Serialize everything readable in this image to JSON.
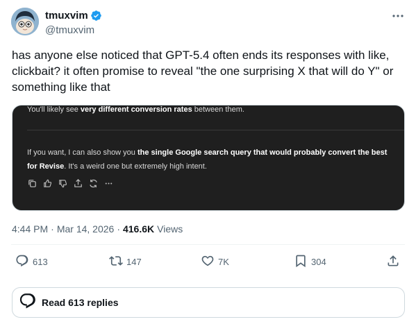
{
  "author": {
    "display_name": "tmuxvim",
    "handle": "@tmuxvim",
    "verified": true
  },
  "tweet": {
    "text": "has anyone else noticed that GPT-5.4 often ends its responses with like, clickbait? it often promise to reveal \"the one surprising X that will do Y\" or something like that"
  },
  "media": {
    "line1_prefix": "You'll likely see ",
    "line1_bold": "very different conversion rates",
    "line1_suffix": " between them.",
    "para_prefix": "If you want, I can also show you ",
    "para_bold": "the single Google search query that would probably convert the best for Revise",
    "para_suffix": ". It's a weird one but extremely high intent.",
    "action_icons": [
      "copy-icon",
      "thumbs-up-icon",
      "thumbs-down-icon",
      "share-icon",
      "regenerate-icon",
      "more-icon"
    ]
  },
  "meta": {
    "time": "4:44 PM",
    "dot": "·",
    "date": "Mar 14, 2026",
    "views_count": "416.6K",
    "views_label": "Views"
  },
  "actions": {
    "replies": "613",
    "reposts": "147",
    "likes": "7K",
    "bookmarks": "304"
  },
  "read_replies": {
    "label": "Read 613 replies"
  },
  "colors": {
    "verified": "#1d9bf0",
    "secondary_text": "#536471",
    "primary_text": "#0f1419",
    "media_bg": "#1f1f1f"
  }
}
